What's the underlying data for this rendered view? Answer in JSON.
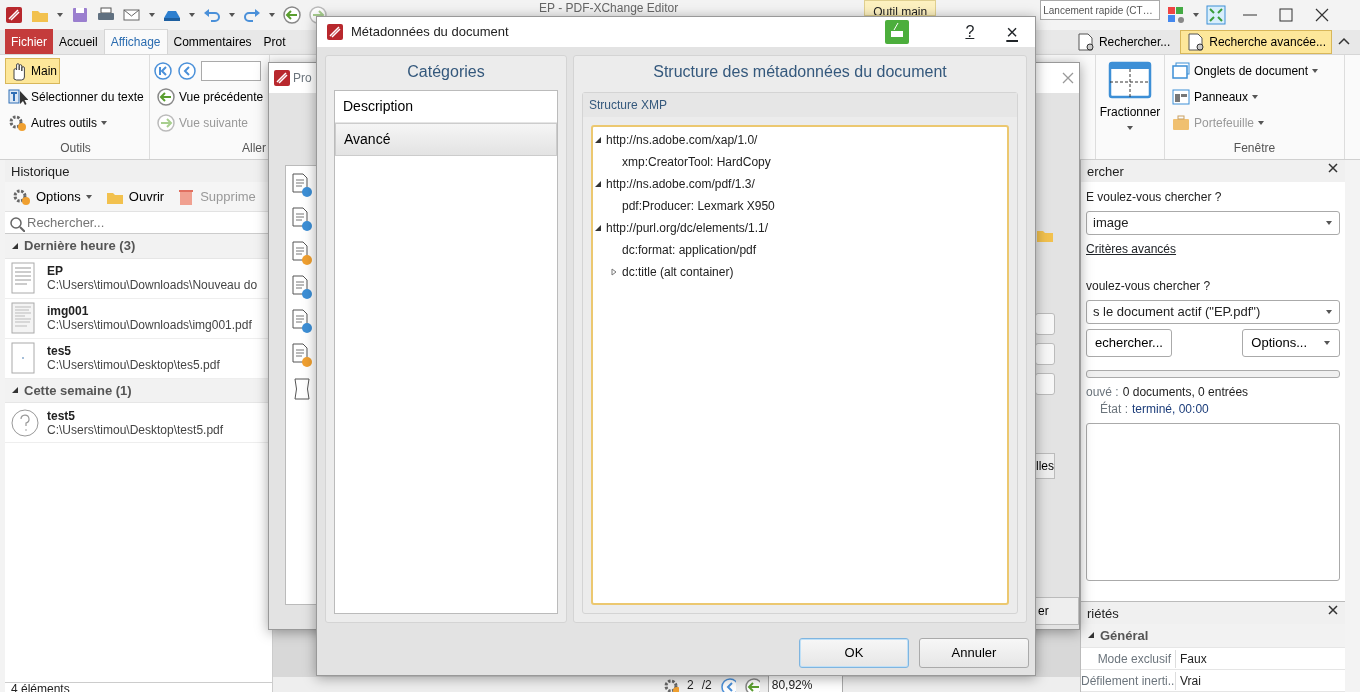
{
  "app": {
    "title": "EP - PDF-XChange Editor",
    "tooltip": "Outil main",
    "quick_launch": {
      "placeholder": "Lancement rapide (CT…"
    }
  },
  "ribbon": {
    "tabs": [
      {
        "label": "Fichier",
        "kind": "file",
        "selected": false
      },
      {
        "label": "Accueil",
        "kind": "tab",
        "selected": false
      },
      {
        "label": "Affichage",
        "kind": "tab",
        "selected": true
      },
      {
        "label": "Commentaires",
        "kind": "tab",
        "selected": false
      },
      {
        "label": "Prot",
        "kind": "tab",
        "selected": false
      }
    ],
    "right_buttons": [
      {
        "label": "Rechercher...",
        "selected": false
      },
      {
        "label": "Recherche avancée...",
        "selected": true
      }
    ],
    "tools_group": {
      "label": "Outils",
      "items": [
        {
          "label": "Main",
          "selected": true
        },
        {
          "label": "Sélectionner du texte",
          "selected": false
        },
        {
          "label": "Autres outils",
          "selected": false
        }
      ]
    },
    "go_group": {
      "label": "Aller",
      "items": [
        {
          "label": "Vue précédente",
          "disabled": false
        },
        {
          "label": "Vue suivante",
          "disabled": true
        }
      ]
    },
    "split": {
      "label": "Fractionner"
    },
    "window_group": {
      "label": "Fenêtre",
      "items": [
        {
          "label": "Onglets de document",
          "disabled": false
        },
        {
          "label": "Panneaux",
          "disabled": false
        },
        {
          "label": "Portefeuille",
          "disabled": true
        }
      ]
    }
  },
  "history": {
    "title": "Historique",
    "toolbar": [
      {
        "label": "Options",
        "disabled": false
      },
      {
        "label": "Ouvrir",
        "disabled": false
      },
      {
        "label": "Supprime",
        "disabled": true
      }
    ],
    "search": {
      "placeholder": "Rechercher..."
    },
    "groups": [
      {
        "label": "Dernière heure (3)",
        "expanded": true,
        "items": [
          {
            "name": "EP",
            "path": "C:\\Users\\timou\\Downloads\\Nouveau do",
            "kind": "text"
          },
          {
            "name": "img001",
            "path": "C:\\Users\\timou\\Downloads\\img001.pdf",
            "kind": "scan"
          },
          {
            "name": "tes5",
            "path": "C:\\Users\\timou\\Desktop\\tes5.pdf",
            "kind": "blank"
          }
        ]
      },
      {
        "label": "Cette semaine (1)",
        "expanded": true,
        "items": [
          {
            "name": "test5",
            "path": "C:\\Users\\timou\\Desktop\\test5.pdf",
            "kind": "missing"
          }
        ]
      }
    ],
    "status": "4 éléments"
  },
  "bottom_toolbar": {
    "page_current": "2",
    "page_total": "/2",
    "zoom": "80,92%"
  },
  "search_pane": {
    "title": "ercher",
    "query_label": "E voulez-vous chercher ?",
    "query": "image",
    "advanced_link": "Critères avancés",
    "scope_label": "voulez-vous chercher ?",
    "scope": "s le document actif (\"EP.pdf\")",
    "search_button": "echercher...",
    "options_button": "Options...",
    "progress": {
      "level": 0
    },
    "found_label": "ouvé :",
    "found": "0 documents, 0 entrées",
    "state_label": "État :",
    "state": "terminé, 00:00"
  },
  "properties_pane": {
    "title": "riétés",
    "section": "Général",
    "rows": [
      {
        "name": "Mode exclusif",
        "value": "Faux"
      },
      {
        "name": "Défilement inerti..",
        "value": "Vrai"
      }
    ]
  },
  "back_dialog": {
    "title": "Pro",
    "buttons": [
      "lles",
      "er"
    ]
  },
  "dialog": {
    "title": "Métadonnées du document",
    "help": "?",
    "close": "×",
    "categories_title": "Catégories",
    "categories": [
      {
        "label": "Description",
        "selected": false
      },
      {
        "label": "Avancé",
        "selected": true
      }
    ],
    "structure_title": "Structure des métadonnées du document",
    "xmp_title": "Structure XMP",
    "tree": [
      {
        "label": "http://ns.adobe.com/xap/1.0/",
        "expanded": true,
        "children": [
          {
            "label": "xmp:CreatorTool: HardCopy"
          }
        ]
      },
      {
        "label": "http://ns.adobe.com/pdf/1.3/",
        "expanded": true,
        "children": [
          {
            "label": "pdf:Producer: Lexmark X950"
          }
        ]
      },
      {
        "label": "http://purl.org/dc/elements/1.1/",
        "expanded": true,
        "children": [
          {
            "label": "dc:format: application/pdf"
          },
          {
            "label": "dc:title (alt container)",
            "expanded": false
          }
        ]
      }
    ],
    "buttons": [
      {
        "label": "OK",
        "kind": "default"
      },
      {
        "label": "Annuler",
        "kind": "normal"
      }
    ]
  }
}
